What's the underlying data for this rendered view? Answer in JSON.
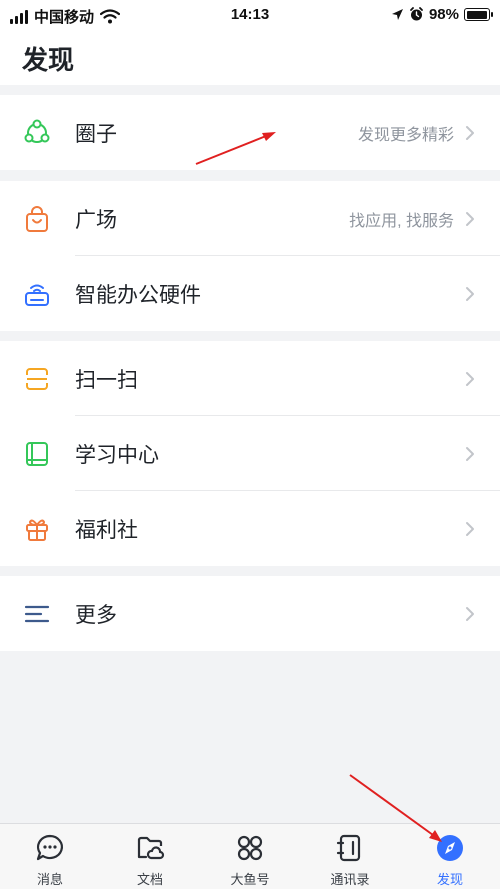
{
  "status_bar": {
    "carrier": "中国移动",
    "time": "14:13",
    "battery": "98%",
    "battery_level": 0.98
  },
  "header": {
    "title": "发现"
  },
  "groups": [
    {
      "items": [
        {
          "label": "圈子",
          "hint": "发现更多精彩",
          "icon": "circle-network-icon",
          "color": "#34c759"
        }
      ]
    },
    {
      "items": [
        {
          "label": "广场",
          "hint": "找应用, 找服务",
          "icon": "shopping-bag-icon",
          "color": "#f07a3c"
        },
        {
          "label": "智能办公硬件",
          "hint": "",
          "icon": "router-device-icon",
          "color": "#3370ff"
        }
      ]
    },
    {
      "items": [
        {
          "label": "扫一扫",
          "hint": "",
          "icon": "scan-icon",
          "color": "#f5a623"
        },
        {
          "label": "学习中心",
          "hint": "",
          "icon": "book-icon",
          "color": "#34c759"
        },
        {
          "label": "福利社",
          "hint": "",
          "icon": "gift-icon",
          "color": "#f07a3c"
        }
      ]
    },
    {
      "items": [
        {
          "label": "更多",
          "hint": "",
          "icon": "more-lines-icon",
          "color": "#3d5a8c"
        }
      ]
    }
  ],
  "tabbar": {
    "tabs": [
      {
        "label": "消息",
        "icon": "message-bubble-icon"
      },
      {
        "label": "文档",
        "icon": "cloud-folder-icon"
      },
      {
        "label": "大鱼号",
        "icon": "four-circles-icon"
      },
      {
        "label": "通讯录",
        "icon": "contacts-book-icon"
      },
      {
        "label": "发现",
        "icon": "discover-icon",
        "active": true
      }
    ]
  },
  "colors": {
    "accent": "#3370ff",
    "annotation_arrow": "#e02020"
  }
}
